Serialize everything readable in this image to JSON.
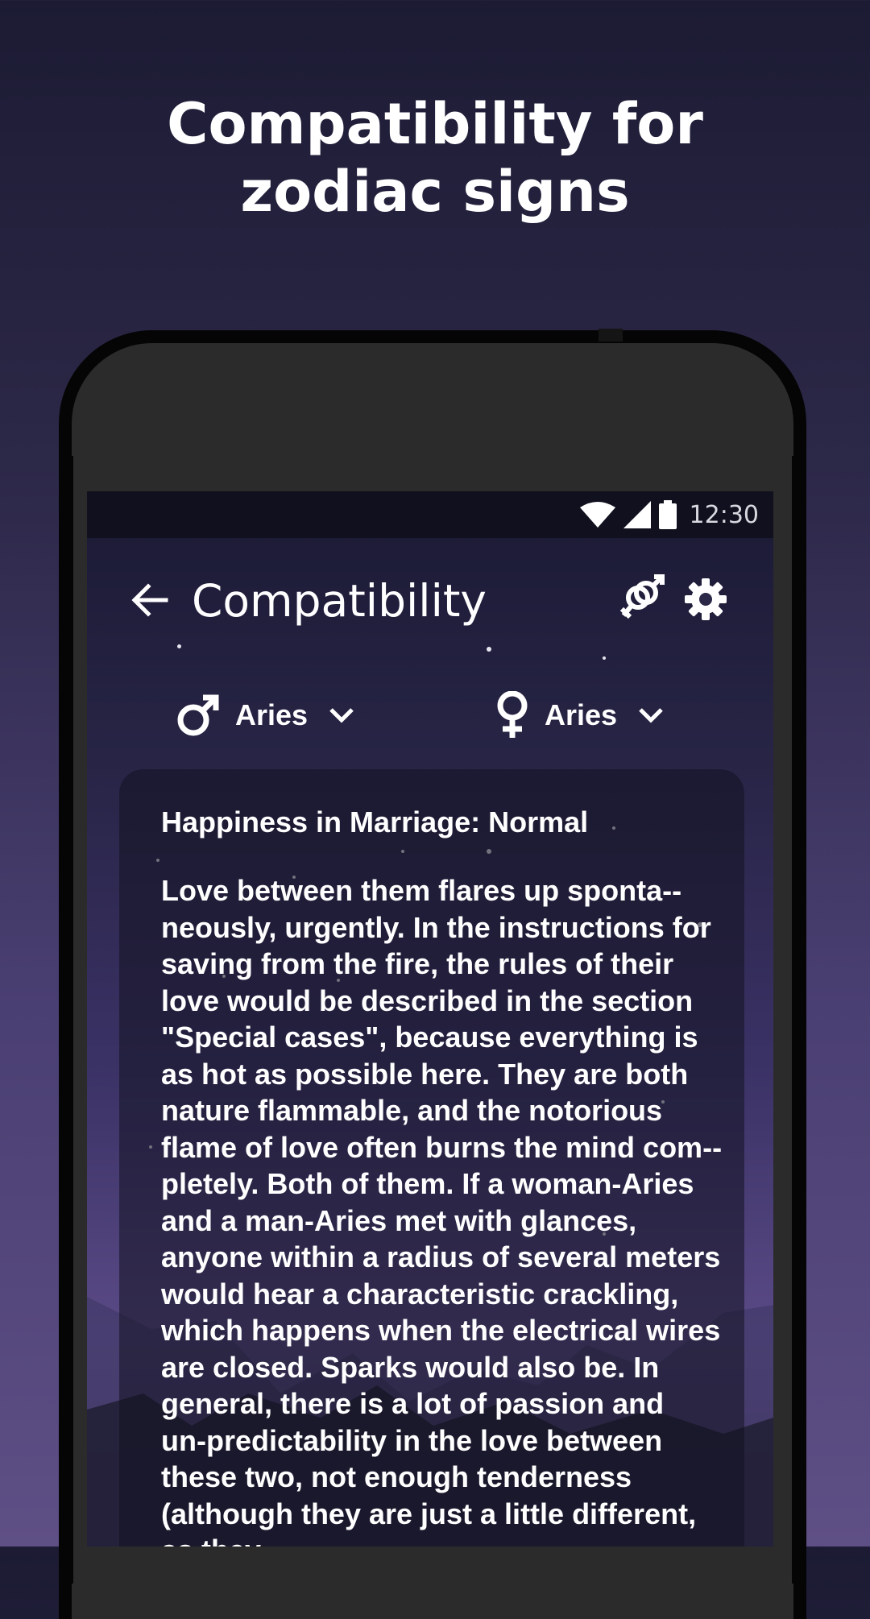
{
  "promo": {
    "title_line1": "Compatibility for",
    "title_line2": "zodiac signs"
  },
  "status_bar": {
    "time": "12:30",
    "icons": [
      "wifi-icon",
      "signal-icon",
      "battery-icon"
    ]
  },
  "toolbar": {
    "title": "Compatibility",
    "back_icon": "arrow-left-icon",
    "gender_icon": "gender-symbols-icon",
    "settings_icon": "gear-icon"
  },
  "selectors": {
    "male": {
      "icon": "male-symbol-icon",
      "value": "Aries"
    },
    "female": {
      "icon": "female-symbol-icon",
      "value": "Aries"
    }
  },
  "card": {
    "heading": "Happiness in Marriage: Normal",
    "body": "Love between them flares up sponta-­neously, urgently. In the instructions for saving from the fire, the rules of their love would be described in the section \"Special cases\", because everything is as hot as possible here. They are both nature flammable, and the notorious flame of love often burns the mind com-­pletely. Both of them. If a woman-Aries and a man-Aries met with glances, anyone within a radius of several meters would hear a characteristic crackling, which happens when the electrical wires are closed. Sparks would also be. In general, there is a lot of passion and un-­predictability in the love between these two, not enough tenderness (although they are just a little different, as they"
  },
  "colors": {
    "background_top": "#1c1b33",
    "background_bottom": "#5e4f85",
    "text": "#ffffff",
    "status_bar": "#10101f"
  }
}
